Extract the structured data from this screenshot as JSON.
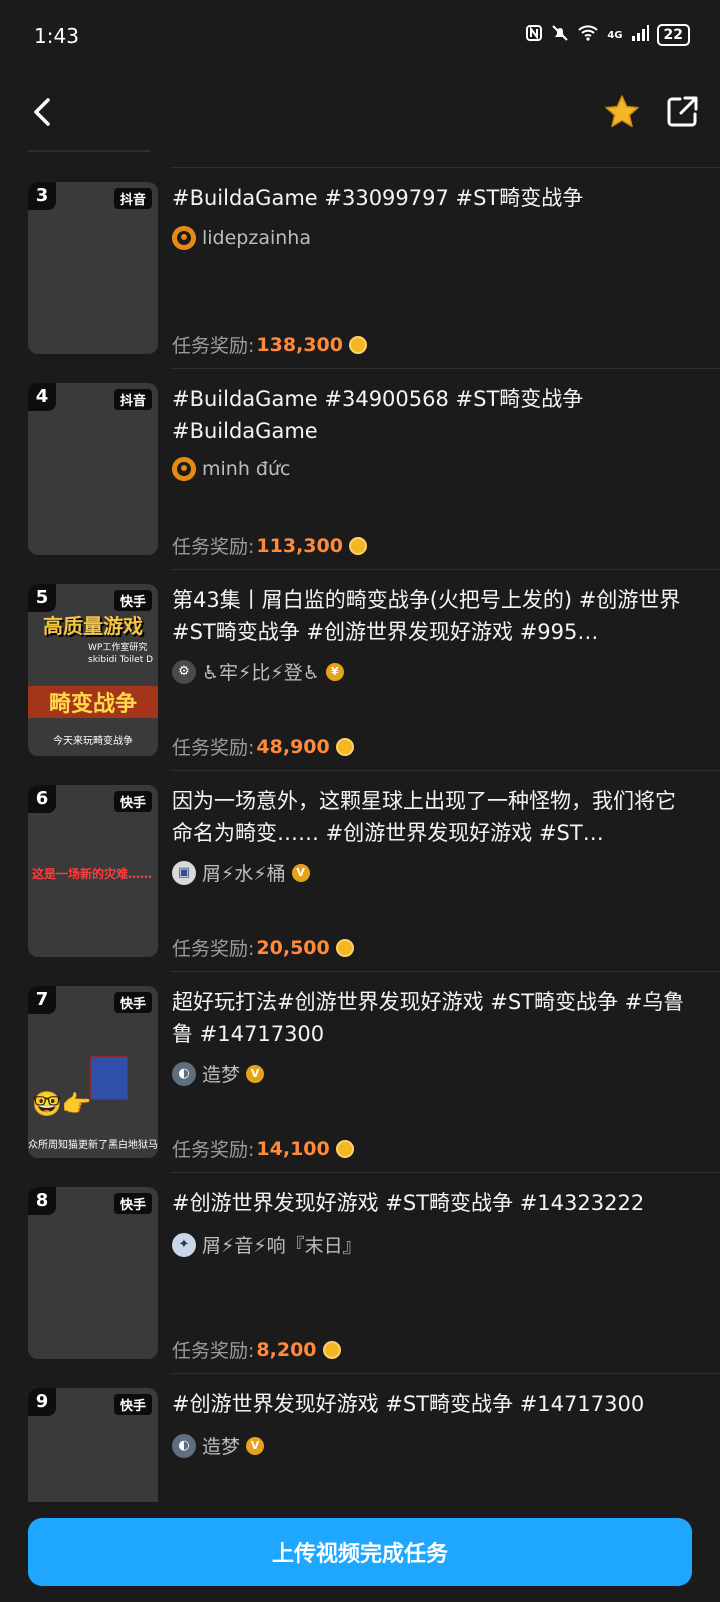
{
  "status_bar": {
    "time": "1:43",
    "icons": [
      "nfc-icon",
      "mute-icon",
      "wifi-icon",
      "signal-icon"
    ],
    "network": "4G",
    "battery": "22"
  },
  "header": {
    "back_icon": "back-icon",
    "favorite_icon": "star-icon",
    "share_icon": "share-icon"
  },
  "items": [
    {
      "rank": "3",
      "platform": "抖音",
      "title": "#BuildaGame #33099797                    #ST畸变战争",
      "author": "lidepzainha",
      "reward_label": "任务奖励:",
      "reward_value": "138,300"
    },
    {
      "rank": "4",
      "platform": "抖音",
      "title": "#BuildaGame #34900568 #ST畸变战争 #BuildaGame",
      "author": "minh đức",
      "reward_label": "任务奖励:",
      "reward_value": "113,300"
    },
    {
      "rank": "5",
      "platform": "快手",
      "title": "第43集丨屑白监的畸变战争(火把号上发的) #创游世界 #ST畸变战争  #创游世界发现好游戏  #995…",
      "author": "♿牢⚡比⚡登♿",
      "reward_label": "任务奖励:",
      "reward_value": "48,900",
      "thumb_text": {
        "banner_top": "高质量游戏",
        "banner_main": "畸变战争",
        "caption": "今天来玩畸变战争",
        "sub1": "WP工作室研究",
        "sub2": "skibidi Toilet D"
      }
    },
    {
      "rank": "6",
      "platform": "快手",
      "title": "因为一场意外，这颗星球上出现了一种怪物，我们将它命名为畸变…… #创游世界发现好游戏 #ST…",
      "author": "屑⚡水⚡桶",
      "reward_label": "任务奖励:",
      "reward_value": "20,500",
      "thumb_text": {
        "caption": "这是一场新的灾难……"
      }
    },
    {
      "rank": "7",
      "platform": "快手",
      "title": "超好玩打法#创游世界发现好游戏 #ST畸变战争 #乌鲁鲁 #14717300",
      "author": "造梦",
      "reward_label": "任务奖励:",
      "reward_value": "14,100",
      "thumb_text": {
        "emoji": "🤓👉",
        "caption": "众所周知猫更新了黑白地狱马桶"
      }
    },
    {
      "rank": "8",
      "platform": "快手",
      "title": "#创游世界发现好游戏 #ST畸变战争 #14323222",
      "author": "屑⚡音⚡响『末日』",
      "reward_label": "任务奖励:",
      "reward_value": "8,200"
    },
    {
      "rank": "9",
      "platform": "快手",
      "title": "#创游世界发现好游戏  #ST畸变战争 #14717300",
      "author": "造梦",
      "reward_label": "",
      "reward_value": ""
    }
  ],
  "bottom": {
    "upload_label": "上传视频完成任务"
  },
  "colors": {
    "accent": "#1fa7ff",
    "reward": "#ff8a3d",
    "star": "#f5b625",
    "background": "#1b1b1b"
  }
}
